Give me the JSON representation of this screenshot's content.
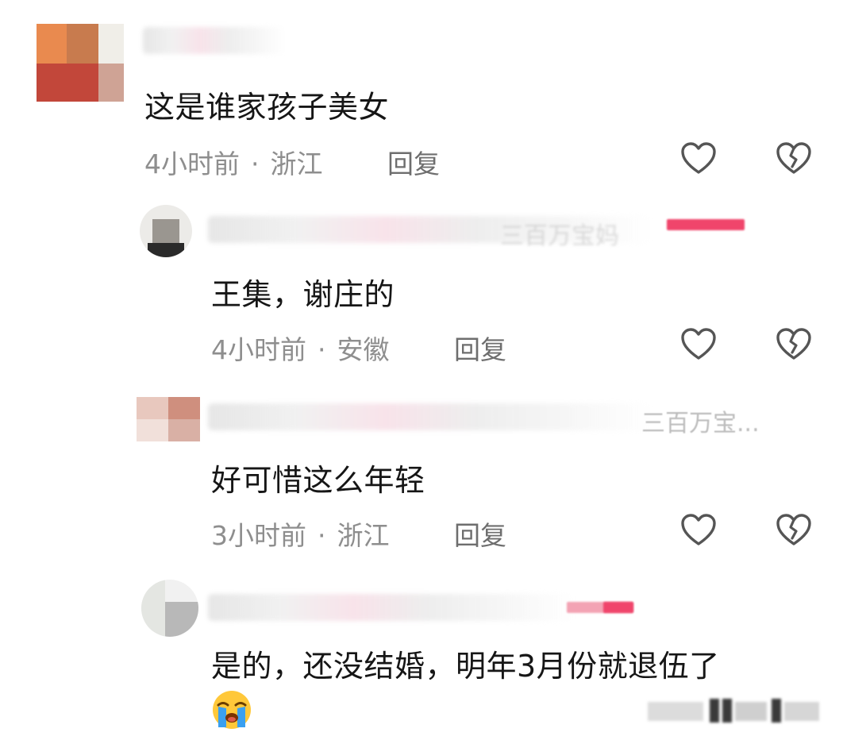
{
  "comments": [
    {
      "text": "这是谁家孩子美女",
      "time": "4小时前",
      "region": "浙江",
      "reply_label": "回复"
    },
    {
      "text": "王集，谢庄的",
      "time": "4小时前",
      "region": "安徽",
      "reply_label": "回复",
      "reply_ref": "三百万宝妈"
    },
    {
      "text": "好可惜这么年轻",
      "time": "3小时前",
      "region": "浙江",
      "reply_label": "回复",
      "reply_ref": "三百万宝..."
    },
    {
      "text": "是的，还没结婚，明年3月份就退伍了"
    }
  ],
  "icons": {
    "like": "heart-outline-icon",
    "dislike": "broken-heart-icon",
    "emoji": "loudly-crying-face-icon"
  },
  "colors": {
    "text": "#161616",
    "meta": "#8e8e8e",
    "badge": "#f0456b"
  }
}
